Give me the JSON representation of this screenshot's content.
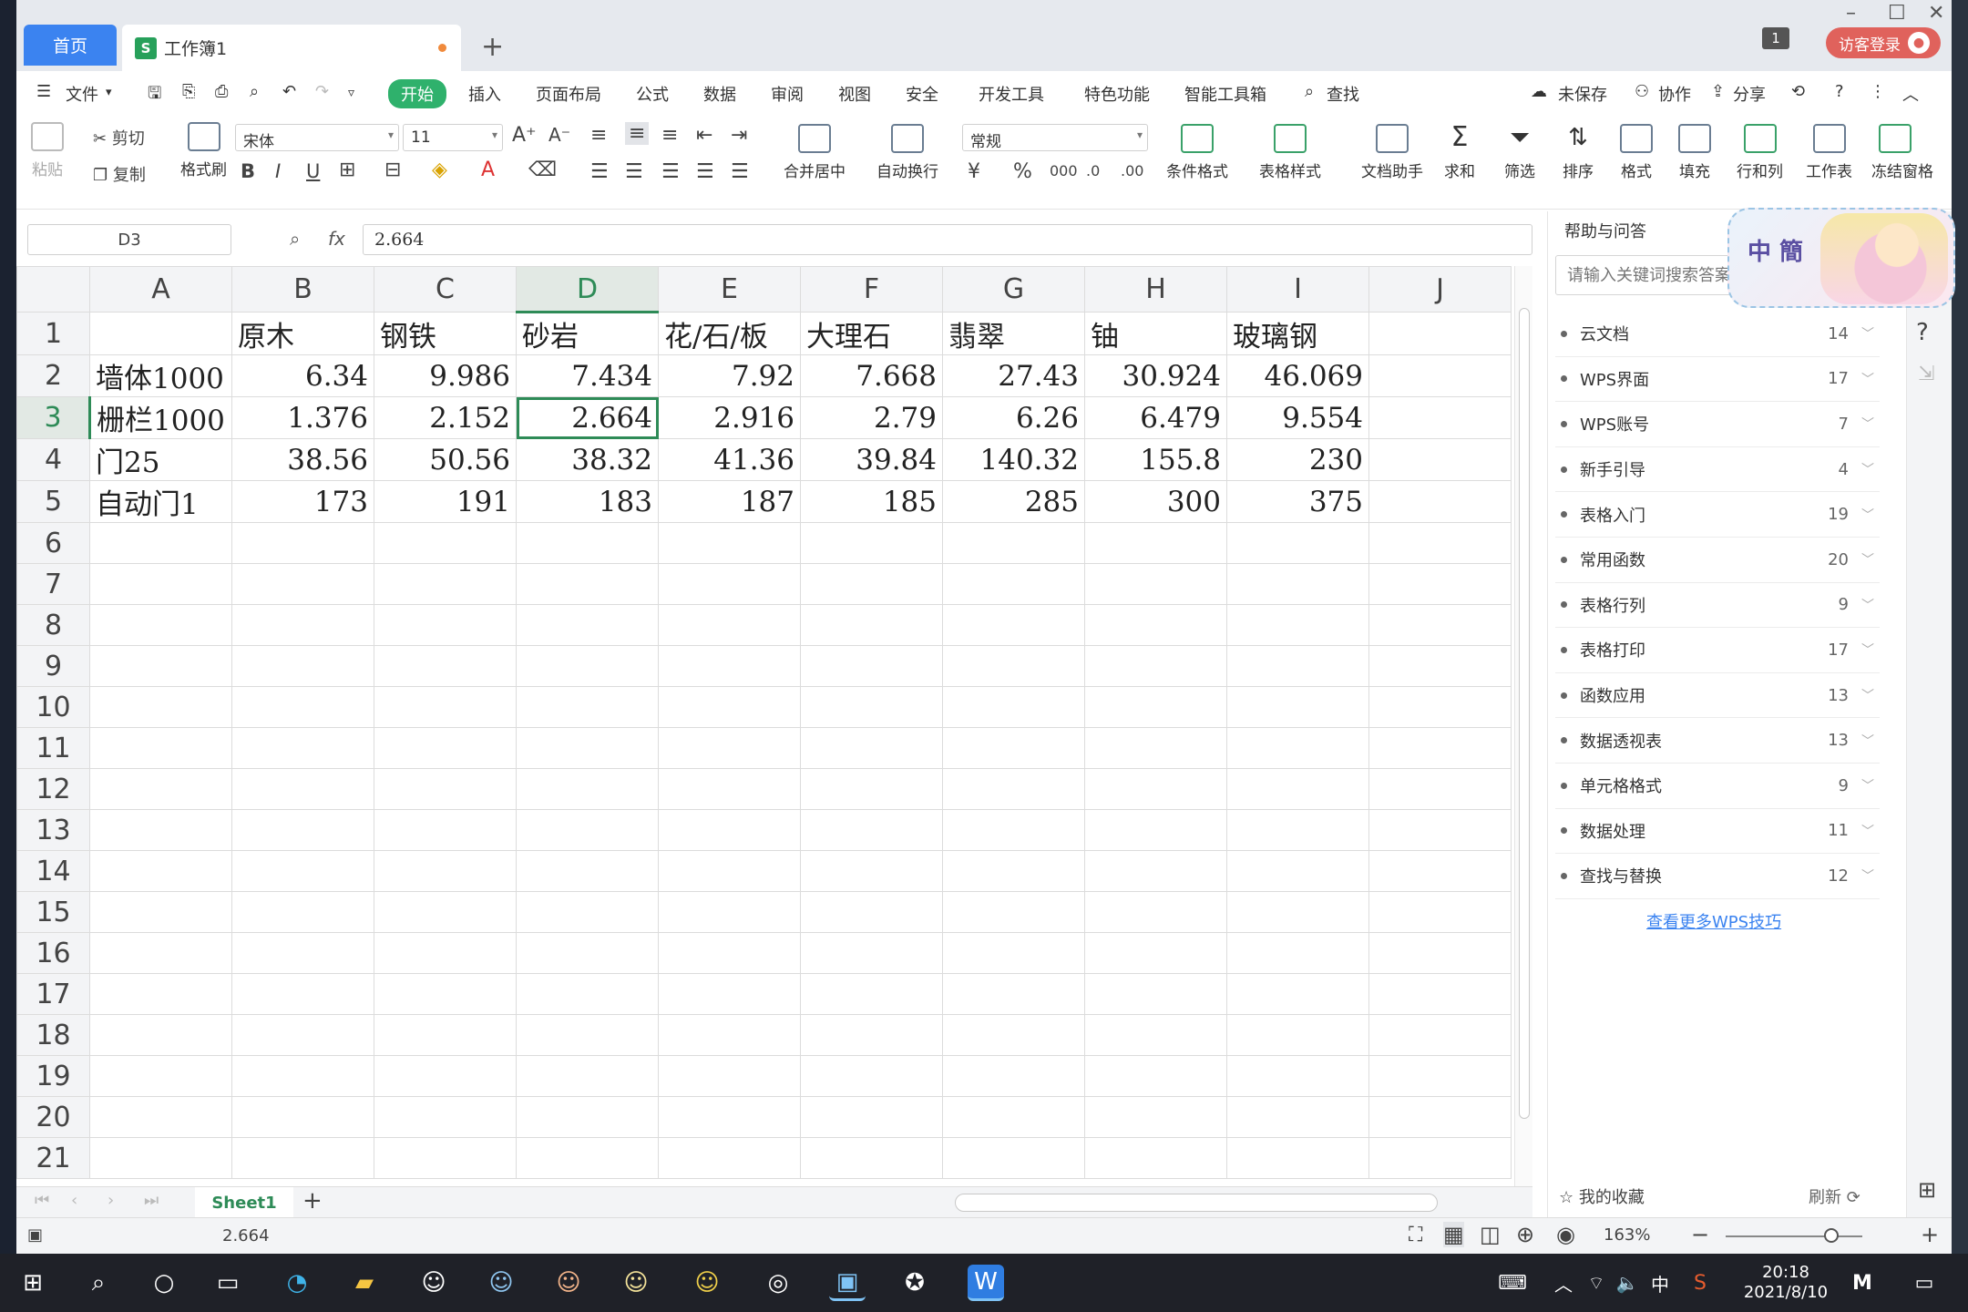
{
  "titlebar": {
    "home_tab": "首页",
    "book_tab": "工作簿1",
    "book_icon": "S",
    "badge": "1",
    "login": "访客登录"
  },
  "menu": {
    "file": "文件",
    "items": [
      "开始",
      "插入",
      "页面布局",
      "公式",
      "数据",
      "审阅",
      "视图",
      "安全",
      "开发工具",
      "特色功能",
      "智能工具箱"
    ],
    "find": "查找",
    "unsaved": "未保存",
    "collab": "协作",
    "share": "分享"
  },
  "ribbon": {
    "paste": "粘贴",
    "cut": "剪切",
    "copy": "复制",
    "format_painter": "格式刷",
    "font_name": "宋体",
    "font_size": "11",
    "number_format": "常规",
    "merge_center": "合并居中",
    "wrap_text": "自动换行",
    "conditional_format": "条件格式",
    "table_style": "表格样式",
    "doc_helper": "文档助手",
    "sum": "求和",
    "filter": "筛选",
    "sort": "排序",
    "format": "格式",
    "fill": "填充",
    "row_col": "行和列",
    "worksheet": "工作表",
    "freeze": "冻结窗格"
  },
  "formula_bar": {
    "name_box": "D3",
    "fx": "fx",
    "value": "2.664"
  },
  "sheet": {
    "columns": [
      "A",
      "B",
      "C",
      "D",
      "E",
      "F",
      "G",
      "H",
      "I",
      "J"
    ],
    "selected_column": "D",
    "selected_row": 3,
    "row_numbers": [
      "1",
      "2",
      "3",
      "4",
      "5",
      "6",
      "7",
      "8",
      "9",
      "10",
      "11",
      "12",
      "13",
      "14",
      "15",
      "16",
      "17",
      "18",
      "19",
      "20",
      "21"
    ],
    "rows": [
      [
        "",
        "原木",
        "钢铁",
        "砂岩",
        "花/石/板",
        "大理石",
        "翡翠",
        "铀",
        "玻璃钢",
        ""
      ],
      [
        "墙体1000",
        "6.34",
        "9.986",
        "7.434",
        "7.92",
        "7.668",
        "27.43",
        "30.924",
        "46.069",
        ""
      ],
      [
        "栅栏1000",
        "1.376",
        "2.152",
        "2.664",
        "2.916",
        "2.79",
        "6.26",
        "6.479",
        "9.554",
        ""
      ],
      [
        "门25",
        "38.56",
        "50.56",
        "38.32",
        "41.36",
        "39.84",
        "140.32",
        "155.8",
        "230",
        ""
      ],
      [
        "自动门1",
        "173",
        "191",
        "183",
        "187",
        "185",
        "285",
        "300",
        "375",
        ""
      ]
    ],
    "tab_name": "Sheet1"
  },
  "status": {
    "value": "2.664",
    "zoom": "163%"
  },
  "help_panel": {
    "title": "帮助与问答",
    "search_placeholder": "请输入关键词搜索答案",
    "topics": [
      {
        "label": "云文档",
        "count": "14"
      },
      {
        "label": "WPS界面",
        "count": "17"
      },
      {
        "label": "WPS账号",
        "count": "7"
      },
      {
        "label": "新手引导",
        "count": "4"
      },
      {
        "label": "表格入门",
        "count": "19"
      },
      {
        "label": "常用函数",
        "count": "20"
      },
      {
        "label": "表格行列",
        "count": "9"
      },
      {
        "label": "表格打印",
        "count": "17"
      },
      {
        "label": "函数应用",
        "count": "13"
      },
      {
        "label": "数据透视表",
        "count": "13"
      },
      {
        "label": "单元格格式",
        "count": "9"
      },
      {
        "label": "数据处理",
        "count": "11"
      },
      {
        "label": "查找与替换",
        "count": "12"
      }
    ],
    "more_link": "查看更多WPS技巧",
    "favorites": "我的收藏",
    "refresh": "刷新"
  },
  "mascot": {
    "text": "中 簡"
  },
  "taskbar": {
    "time": "20:18",
    "date": "2021/8/10",
    "ime": "中"
  },
  "colors": {
    "accent": "#2e8b57",
    "home_tab": "#3b83f0",
    "login": "#e0625c",
    "start": "#2fb16c"
  }
}
